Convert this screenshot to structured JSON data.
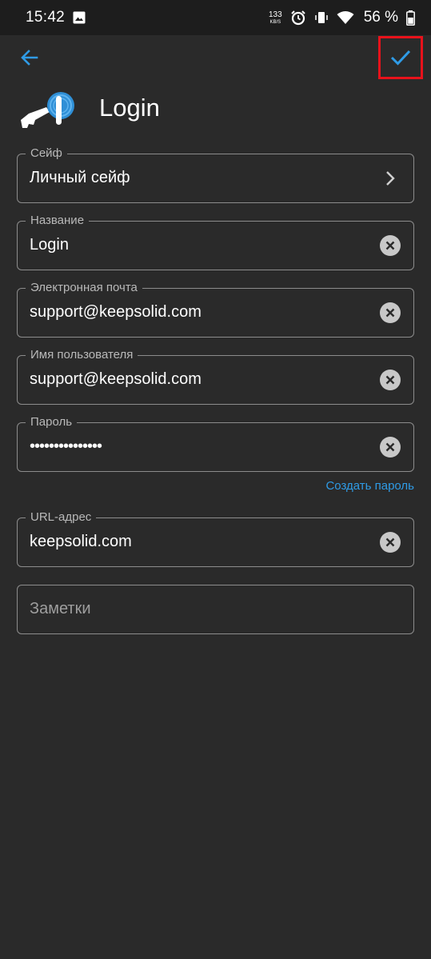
{
  "status_bar": {
    "time": "15:42",
    "net_speed_value": "133",
    "net_speed_unit": "KB/S",
    "battery_percent": "56 %"
  },
  "header": {
    "title": "Login"
  },
  "fields": {
    "vault": {
      "label": "Сейф",
      "value": "Личный сейф"
    },
    "name": {
      "label": "Название",
      "value": "Login"
    },
    "email": {
      "label": "Электронная почта",
      "value": "support@keepsolid.com"
    },
    "username": {
      "label": "Имя пользователя",
      "value": "support@keepsolid.com"
    },
    "password": {
      "label": "Пароль",
      "value": "•••••••••••••••"
    },
    "url": {
      "label": "URL-адрес",
      "value": "keepsolid.com"
    },
    "notes": {
      "placeholder": "Заметки"
    }
  },
  "generate_password_label": "Создать пароль",
  "colors": {
    "background": "#2a2a2a",
    "accent": "#2f9be6",
    "highlight_box": "#e8121b"
  },
  "icons": [
    "back-arrow-icon",
    "checkmark-icon",
    "login-key-icon",
    "chevron-right-icon",
    "clear-icon"
  ]
}
